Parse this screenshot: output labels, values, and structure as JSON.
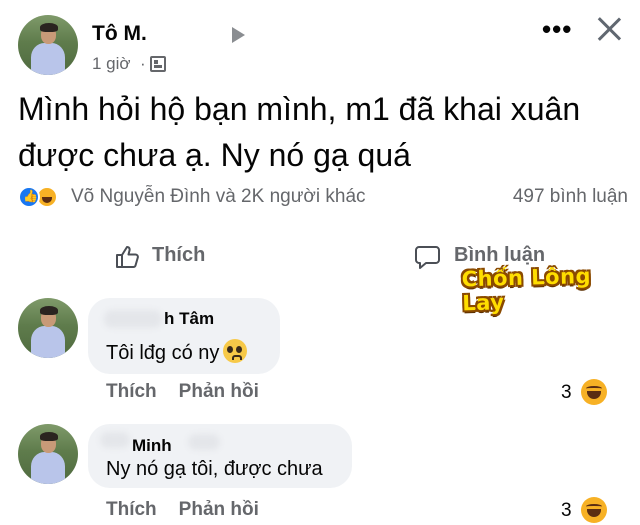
{
  "post": {
    "author": "Tô M.",
    "time": "1 giờ",
    "separator": "·",
    "text": "Mình hỏi hộ bạn mình, m1 đã khai xuân được chưa ạ. Ny nó gạ quá",
    "reactions_text": "Võ Nguyễn Đình và 2K người khác",
    "comments_count": "497 bình luận",
    "like_label": "Thích",
    "comment_label": "Bình luận"
  },
  "watermark": "Chốn Lông Lay",
  "comments": [
    {
      "name": "h Tâm",
      "text": "Tôi lđg có ny",
      "like_action": "Thích",
      "reply_action": "Phản hồi",
      "reaction_count": "3"
    },
    {
      "name": "Minh",
      "text": "Ny nó gạ tôi, được chưa",
      "like_action": "Thích",
      "reply_action": "Phản hồi",
      "reaction_count": "3"
    }
  ],
  "colors": {
    "accent": "#1877f2",
    "muted_text": "#65676b",
    "bubble": "#f0f2f5",
    "watermark": "#ffde00"
  },
  "icons": [
    "like-icon",
    "haha-icon",
    "play-icon",
    "globe-icon",
    "more-icon",
    "close-icon",
    "thumbs-up-icon",
    "comment-icon",
    "pleading-face-icon"
  ]
}
